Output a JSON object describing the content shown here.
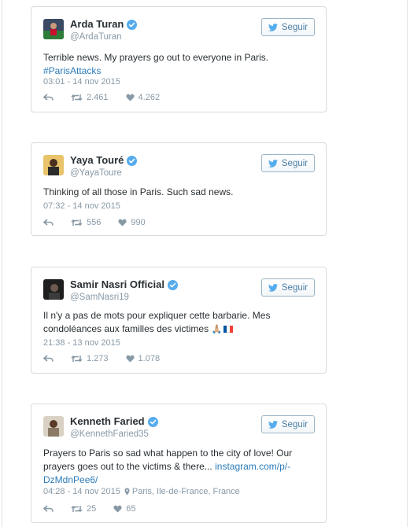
{
  "follow_label": "Seguir",
  "tweets": [
    {
      "name": "Arda Turan",
      "handle": "@ArdaTuran",
      "text": "Terrible news. My prayers go out to everyone in Paris.",
      "hashtag": "#ParisAttacks",
      "timestamp": "03:01 - 14 nov 2015",
      "retweets": "2.461",
      "likes": "4.262"
    },
    {
      "name": "Yaya Touré",
      "handle": "@YayaToure",
      "text": "Thinking of all those in Paris. Such sad news.",
      "timestamp": "07:32 - 14 nov 2015",
      "retweets": "556",
      "likes": "990"
    },
    {
      "name": "Samir Nasri Official",
      "handle": "@SamNasri19",
      "text": "Il n'y a pas de mots pour expliquer cette barbarie. Mes condoléances aux familles des victimes",
      "emoji_hands": "🙏🏼",
      "timestamp": "21:38 - 13 nov 2015",
      "retweets": "1.273",
      "likes": "1.078"
    },
    {
      "name": "Kenneth Faried",
      "handle": "@KennethFaried35",
      "text": "Prayers to Paris so sad what happen to the city of love! Our prayers goes out to the victims & there...",
      "link": "instagram.com/p/-DzMdnPee6/",
      "timestamp": "04:28 - 14 nov 2015",
      "location": "Paris, Ile-de-France, France",
      "retweets": "25",
      "likes": "65"
    }
  ],
  "colors": {
    "link": "#2b7bb9",
    "meta": "#8899a6",
    "text": "#292f33",
    "verified": "#55acee",
    "border": "#dadada"
  },
  "icons": [
    "verified-badge-icon",
    "twitter-bird-icon",
    "reply-icon",
    "retweet-icon",
    "heart-icon",
    "location-pin-icon"
  ]
}
